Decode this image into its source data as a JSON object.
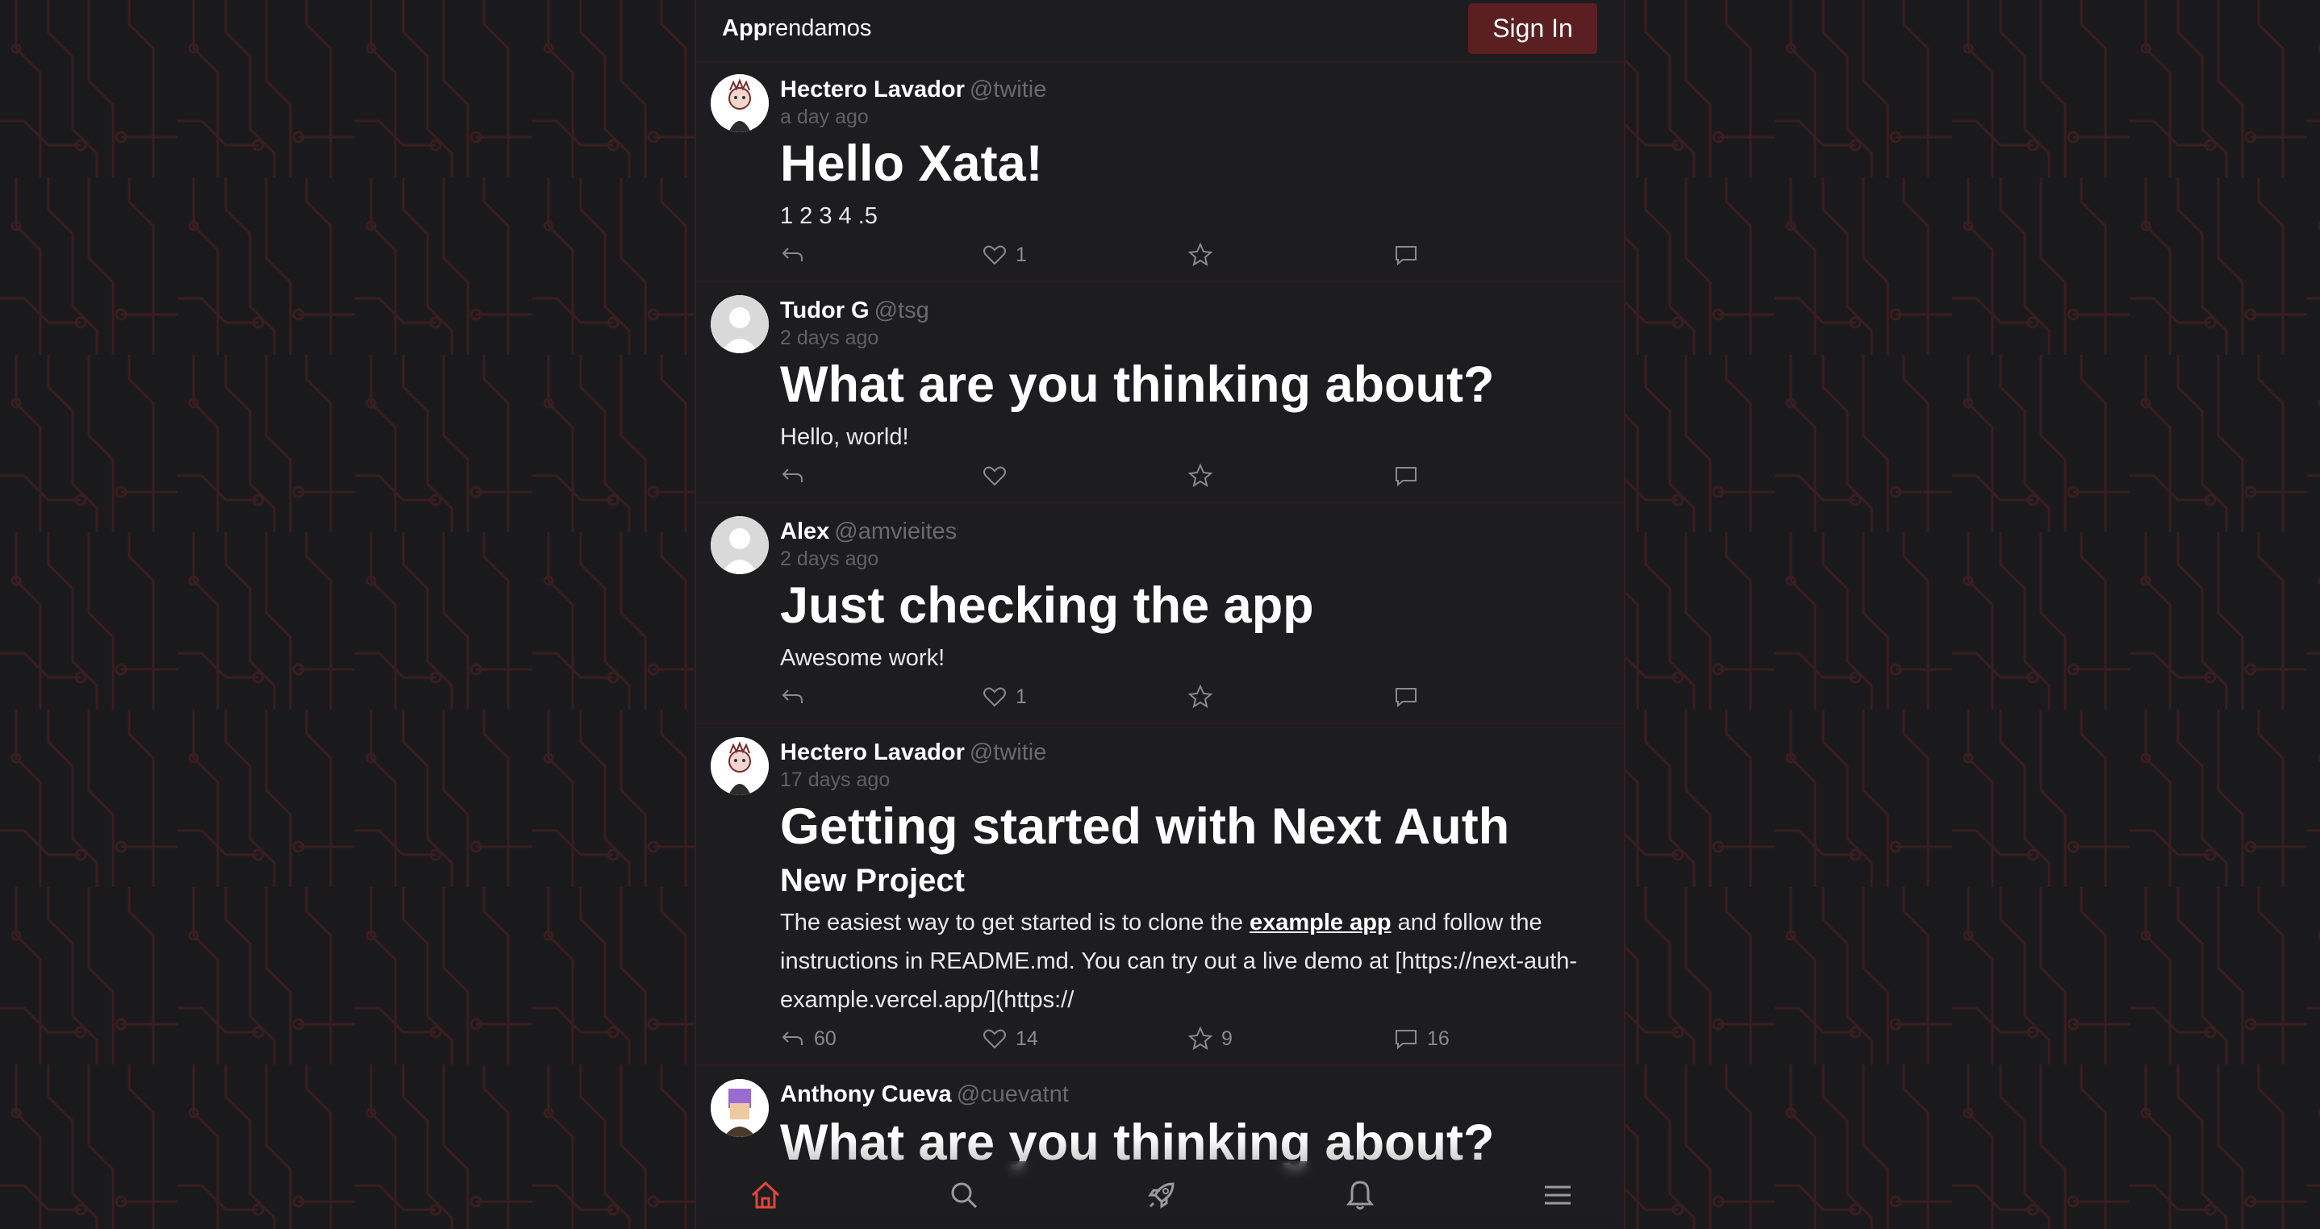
{
  "header": {
    "brand_bold": "App",
    "brand_rest": "rendamos",
    "signin_label": "Sign In"
  },
  "posts": [
    {
      "name": "Hectero Lavador",
      "handle": "@twitie",
      "time": "a day ago",
      "title": "Hello Xata!",
      "body": "1 2 3 4 .5",
      "replies": "",
      "likes": "1",
      "stars": "",
      "comments": ""
    },
    {
      "name": "Tudor G",
      "handle": "@tsg",
      "time": "2 days ago",
      "title": "What are you thinking about?",
      "body": "Hello, world!",
      "replies": "",
      "likes": "",
      "stars": "",
      "comments": ""
    },
    {
      "name": "Alex",
      "handle": "@amvieites",
      "time": "2 days ago",
      "title": "Just checking the app",
      "body": "Awesome work!",
      "replies": "",
      "likes": "1",
      "stars": "",
      "comments": ""
    },
    {
      "name": "Hectero Lavador",
      "handle": "@twitie",
      "time": "17 days ago",
      "title": "Getting started with Next Auth",
      "subtitle": "New Project",
      "body_before": "The easiest way to get started is to clone the ",
      "body_link": "example app",
      "body_after": " and follow the instructions in README.md. You can try out a live demo at [https://next-auth-example.vercel.app/](https://",
      "replies": "60",
      "likes": "14",
      "stars": "9",
      "comments": "16"
    },
    {
      "name": "Anthony Cueva",
      "handle": "@cuevatnt",
      "time": "",
      "title": "What are you thinking about?"
    }
  ],
  "nav": {
    "items": [
      "home-icon",
      "search-icon",
      "rocket-icon",
      "bell-icon",
      "menu-icon"
    ],
    "active": "home-icon",
    "active_color": "#e0463e"
  },
  "colors": {
    "accent": "#5b1f22",
    "background": "#1a1a1c"
  }
}
